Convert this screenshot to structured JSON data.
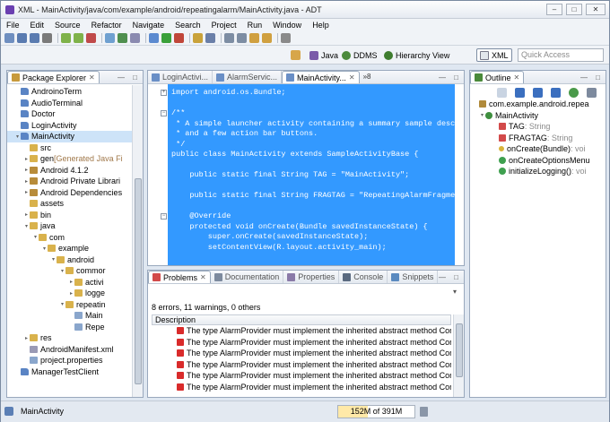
{
  "window": {
    "title": "XML - MainActivity/java/com/example/android/repeatingalarm/MainActivity.java - ADT",
    "buttons": {
      "minimize": "–",
      "maximize": "□",
      "close": "✕"
    }
  },
  "menu": [
    "File",
    "Edit",
    "Source",
    "Refactor",
    "Navigate",
    "Search",
    "Project",
    "Run",
    "Window",
    "Help"
  ],
  "perspectives": [
    {
      "label": "Java",
      "active": false
    },
    {
      "label": "DDMS",
      "active": false
    },
    {
      "label": "Hierarchy View",
      "active": false
    },
    {
      "label": "XML",
      "active": true
    }
  ],
  "quick_access": {
    "placeholder": "Quick Access"
  },
  "package_explorer": {
    "tab": "Package Explorer",
    "items": [
      {
        "label": "AndroinoTerm",
        "depth": 0,
        "twisty": "",
        "icon": "project"
      },
      {
        "label": "AudioTerminal",
        "depth": 0,
        "twisty": "",
        "icon": "project"
      },
      {
        "label": "Doctor",
        "depth": 0,
        "twisty": "",
        "icon": "project"
      },
      {
        "label": "LoginActivity",
        "depth": 0,
        "twisty": "",
        "icon": "project"
      },
      {
        "label": "MainActivity",
        "depth": 0,
        "twisty": "▾",
        "icon": "project",
        "selected": true
      },
      {
        "label": "src",
        "depth": 1,
        "twisty": "",
        "icon": "folder"
      },
      {
        "label": "gen",
        "suffix": " [Generated Java Fi",
        "depth": 1,
        "twisty": "▸",
        "icon": "folder"
      },
      {
        "label": "Android 4.1.2",
        "depth": 1,
        "twisty": "▸",
        "icon": "lib"
      },
      {
        "label": "Android Private Librari",
        "depth": 1,
        "twisty": "▸",
        "icon": "lib"
      },
      {
        "label": "Android Dependencies",
        "depth": 1,
        "twisty": "▸",
        "icon": "lib"
      },
      {
        "label": "assets",
        "depth": 1,
        "twisty": "",
        "icon": "folder"
      },
      {
        "label": "bin",
        "depth": 1,
        "twisty": "▸",
        "icon": "folder"
      },
      {
        "label": "java",
        "depth": 1,
        "twisty": "▾",
        "icon": "folder"
      },
      {
        "label": "com",
        "depth": 2,
        "twisty": "▾",
        "icon": "folder"
      },
      {
        "label": "example",
        "depth": 3,
        "twisty": "▾",
        "icon": "folder"
      },
      {
        "label": "android",
        "depth": 4,
        "twisty": "▾",
        "icon": "folder"
      },
      {
        "label": "commor",
        "depth": 5,
        "twisty": "▾",
        "icon": "folder"
      },
      {
        "label": "activi",
        "depth": 6,
        "twisty": "▸",
        "icon": "folder"
      },
      {
        "label": "logge",
        "depth": 6,
        "twisty": "▸",
        "icon": "folder"
      },
      {
        "label": "repeatin",
        "depth": 5,
        "twisty": "▾",
        "icon": "folder"
      },
      {
        "label": "Main",
        "depth": 6,
        "twisty": "",
        "icon": "file"
      },
      {
        "label": "Repe",
        "depth": 6,
        "twisty": "",
        "icon": "file"
      },
      {
        "label": "res",
        "depth": 1,
        "twisty": "▸",
        "icon": "folder"
      },
      {
        "label": "AndroidManifest.xml",
        "depth": 1,
        "twisty": "",
        "icon": "xml"
      },
      {
        "label": "project.properties",
        "depth": 1,
        "twisty": "",
        "icon": "file"
      },
      {
        "label": "ManagerTestClient",
        "depth": 0,
        "twisty": "",
        "icon": "project"
      }
    ]
  },
  "editor": {
    "tabs": [
      {
        "label": "LoginActivi...",
        "active": false
      },
      {
        "label": "AlarmServic...",
        "active": false
      },
      {
        "label": "MainActivity...",
        "active": true
      }
    ],
    "overflow": "»8",
    "lines": [
      {
        "text": "import android.os.Bundle;",
        "fold": "+"
      },
      {
        "text": "",
        "fold": ""
      },
      {
        "text": "/**",
        "fold": "−"
      },
      {
        "text": " * A simple launcher activity containing a summary sample desc",
        "fold": ""
      },
      {
        "text": " * and a few action bar buttons.",
        "fold": ""
      },
      {
        "text": " */",
        "fold": ""
      },
      {
        "text": "public class MainActivity extends SampleActivityBase {",
        "fold": ""
      },
      {
        "text": "",
        "fold": ""
      },
      {
        "text": "    public static final String TAG = \"MainActivity\";",
        "fold": ""
      },
      {
        "text": "",
        "fold": ""
      },
      {
        "text": "    public static final String FRAGTAG = \"RepeatingAlarmFragme",
        "fold": ""
      },
      {
        "text": "",
        "fold": ""
      },
      {
        "text": "    @Override",
        "fold": "−"
      },
      {
        "text": "    protected void onCreate(Bundle savedInstanceState) {",
        "fold": ""
      },
      {
        "text": "        super.onCreate(savedInstanceState);",
        "fold": ""
      },
      {
        "text": "        setContentView(R.layout.activity_main);",
        "fold": ""
      }
    ]
  },
  "outline": {
    "tab": "Outline",
    "items": [
      {
        "label": "com.example.android.repea",
        "depth": 0,
        "twisty": "",
        "icon": "package"
      },
      {
        "label": "MainActivity",
        "depth": 0,
        "twisty": "▾",
        "icon": "class"
      },
      {
        "label": "TAG",
        "type": " : String",
        "depth": 1,
        "icon": "field"
      },
      {
        "label": "FRAGTAG",
        "type": " : String",
        "depth": 1,
        "icon": "field"
      },
      {
        "label": "onCreate(Bundle)",
        "type": " : voi",
        "depth": 1,
        "icon": "method-protected"
      },
      {
        "label": "onCreateOptionsMenu",
        "type": "",
        "depth": 1,
        "icon": "method"
      },
      {
        "label": "initializeLogging()",
        "type": " : voi",
        "depth": 1,
        "icon": "method"
      }
    ]
  },
  "bottom": {
    "tabs": [
      {
        "label": "Problems",
        "active": true
      },
      {
        "label": "Documentation",
        "active": false
      },
      {
        "label": "Properties",
        "active": false
      },
      {
        "label": "Console",
        "active": false
      },
      {
        "label": "Snippets",
        "active": false
      }
    ],
    "summary": "8 errors, 11 warnings, 0 others",
    "column": "Description",
    "rows": [
      "The type AlarmProvider must implement the inherited abstract method Conte",
      "The type AlarmProvider must implement the inherited abstract method Conte",
      "The type AlarmProvider must implement the inherited abstract method Conte",
      "The type AlarmProvider must implement the inherited abstract method Conte",
      "The type AlarmProvider must implement the inherited abstract method Conte",
      "The type AlarmProvider must implement the inherited abstract method Conte"
    ]
  },
  "status": {
    "selection": "MainActivity",
    "heap": "152M of 391M",
    "heap_used_fraction": 0.39
  },
  "colors": {
    "selection_blue": "#3399ff",
    "tree_selection": "#cde3f8",
    "error_red": "#d92b2b"
  }
}
